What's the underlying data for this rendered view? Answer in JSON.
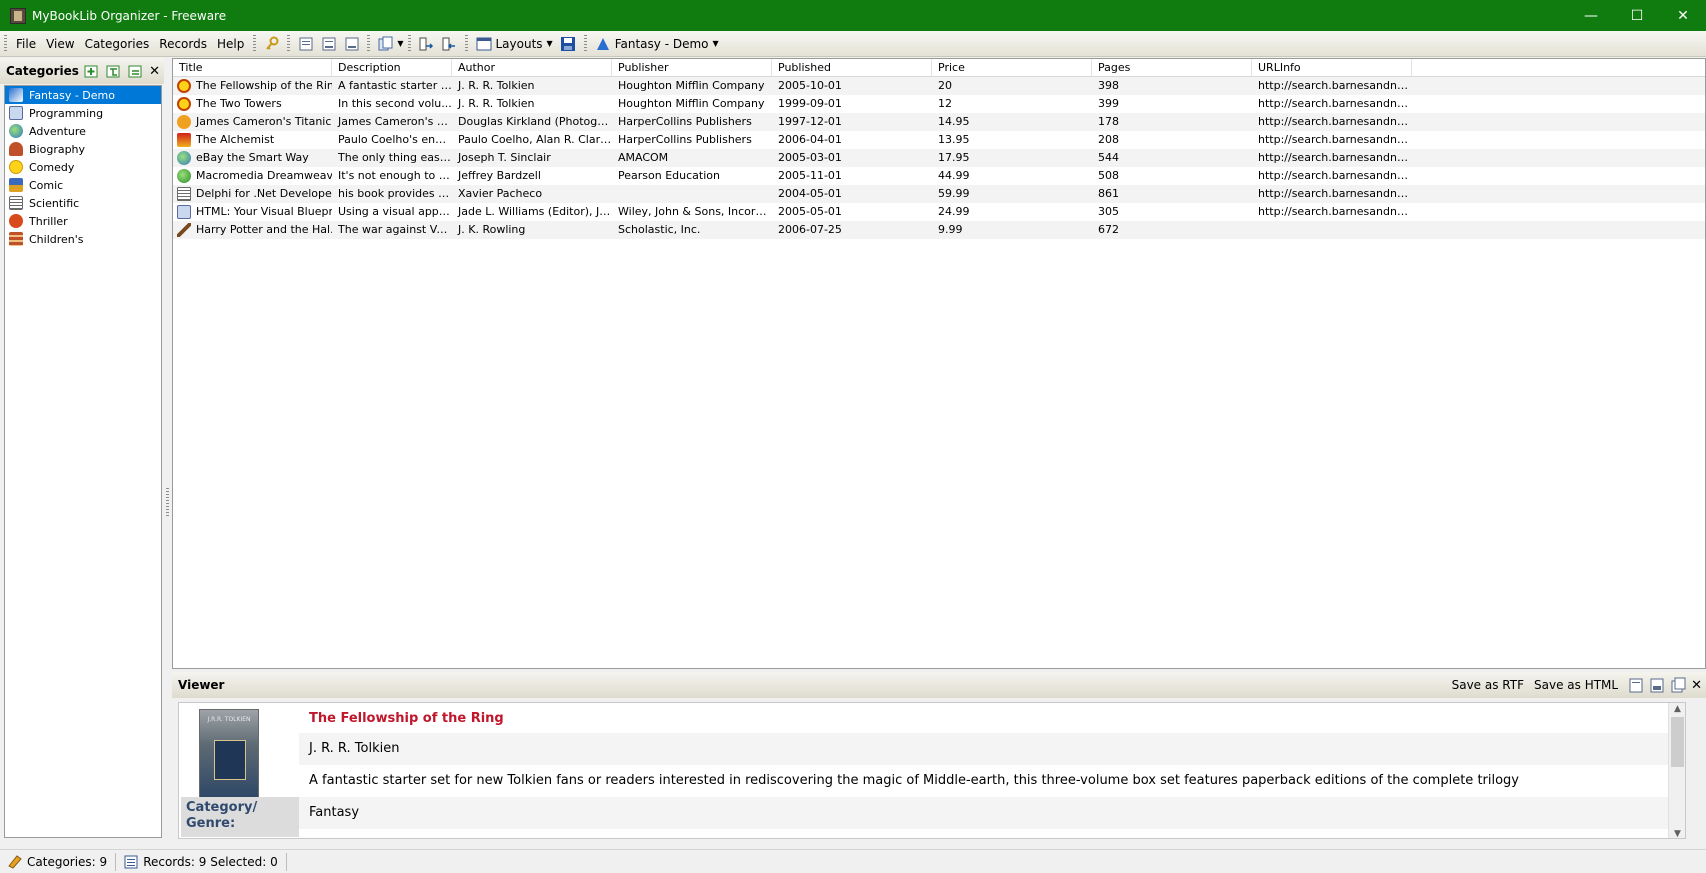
{
  "window": {
    "title": "MyBookLib Organizer - Freeware",
    "controls": [
      "minimize",
      "maximize",
      "close"
    ],
    "colors": {
      "titlebar": "#107c10",
      "selection": "#0078d7",
      "viewer_title": "#c0172c"
    }
  },
  "menu": {
    "file": "File",
    "view": "View",
    "categories": "Categories",
    "records": "Records",
    "help": "Help"
  },
  "toolbar": {
    "layouts_label": "Layouts",
    "current_category": "Fantasy - Demo"
  },
  "categories_panel": {
    "title": "Categories",
    "items": [
      {
        "label": "Fantasy - Demo",
        "icon": "fantasy-icon",
        "selected": true
      },
      {
        "label": "Programming",
        "icon": "programming-icon"
      },
      {
        "label": "Adventure",
        "icon": "globe-icon"
      },
      {
        "label": "Biography",
        "icon": "person-icon"
      },
      {
        "label": "Comedy",
        "icon": "smiley-icon"
      },
      {
        "label": "Comic",
        "icon": "comic-icon"
      },
      {
        "label": "Scientific",
        "icon": "scientific-icon"
      },
      {
        "label": "Thriller",
        "icon": "thriller-icon"
      },
      {
        "label": "Children's",
        "icon": "children-icon"
      }
    ]
  },
  "grid": {
    "columns": [
      "Title",
      "Description",
      "Author",
      "Publisher",
      "Published",
      "Price",
      "Pages",
      "URLInfo"
    ],
    "rows": [
      {
        "title": "The Fellowship of the Ring",
        "description": "A fantastic starter s...",
        "author": "J. R. R. Tolkien",
        "publisher": "Houghton Mifflin Company",
        "published": "2005-10-01",
        "price": "20",
        "pages": "398",
        "url": "http://search.barnesandno..."
      },
      {
        "title": "The Two Towers",
        "description": "In this second volu...",
        "author": "J. R. R. Tolkien",
        "publisher": "Houghton Mifflin Company",
        "published": "1999-09-01",
        "price": "12",
        "pages": "399",
        "url": "http://search.barnesandno..."
      },
      {
        "title": "James Cameron's Titanic",
        "description": "James Cameron's Ti...",
        "author": "Douglas Kirkland (Photograp...",
        "publisher": "HarperCollins Publishers",
        "published": "1997-12-01",
        "price": "14.95",
        "pages": "178",
        "url": "http://search.barnesandno..."
      },
      {
        "title": "The Alchemist",
        "description": "Paulo Coelho's ench...",
        "author": "Paulo Coelho, Alan R. Clark...",
        "publisher": "HarperCollins Publishers",
        "published": "2006-04-01",
        "price": "13.95",
        "pages": "208",
        "url": "http://search.barnesandno..."
      },
      {
        "title": "eBay the Smart Way",
        "description": "The only thing easie...",
        "author": "Joseph T. Sinclair",
        "publisher": "AMACOM",
        "published": "2005-03-01",
        "price": "17.95",
        "pages": "544",
        "url": "http://search.barnesandno..."
      },
      {
        "title": "Macromedia Dreamweav...",
        "description": "It's not enough to b...",
        "author": "Jeffrey Bardzell",
        "publisher": "Pearson Education",
        "published": "2005-11-01",
        "price": "44.99",
        "pages": "508",
        "url": "http://search.barnesandno..."
      },
      {
        "title": "Delphi for .Net Develope...",
        "description": "his book provides e...",
        "author": "Xavier Pacheco",
        "publisher": "",
        "published": "2004-05-01",
        "price": "59.99",
        "pages": "861",
        "url": "http://search.barnesandno..."
      },
      {
        "title": "HTML: Your Visual Bluepr...",
        "description": "Using a visual appro...",
        "author": "Jade L. Williams (Editor), Ja...",
        "publisher": "Wiley, John & Sons, Incorpo...",
        "published": "2005-05-01",
        "price": "24.99",
        "pages": "305",
        "url": "http://search.barnesandno..."
      },
      {
        "title": "Harry Potter and the Hal...",
        "description": "The war against Vol...",
        "author": "J. K. Rowling",
        "publisher": "Scholastic, Inc.",
        "published": "2006-07-25",
        "price": "9.99",
        "pages": "672",
        "url": ""
      }
    ]
  },
  "viewer": {
    "title": "Viewer",
    "save_rtf": "Save as RTF",
    "save_html": "Save as HTML",
    "book_title": "The Fellowship of the Ring",
    "author": "J. R. R. Tolkien",
    "description": "A fantastic starter set for new Tolkien fans or readers interested in rediscovering the magic of Middle-earth, this three-volume box set features paperback editions of the complete trilogy",
    "category_label": "Category/ Genre:",
    "category_value": "Fantasy",
    "cover": {
      "author_text": "J.R.R. TOLKIEN"
    }
  },
  "status": {
    "categories": "Categories: 9",
    "records": "Records: 9 Selected: 0"
  }
}
